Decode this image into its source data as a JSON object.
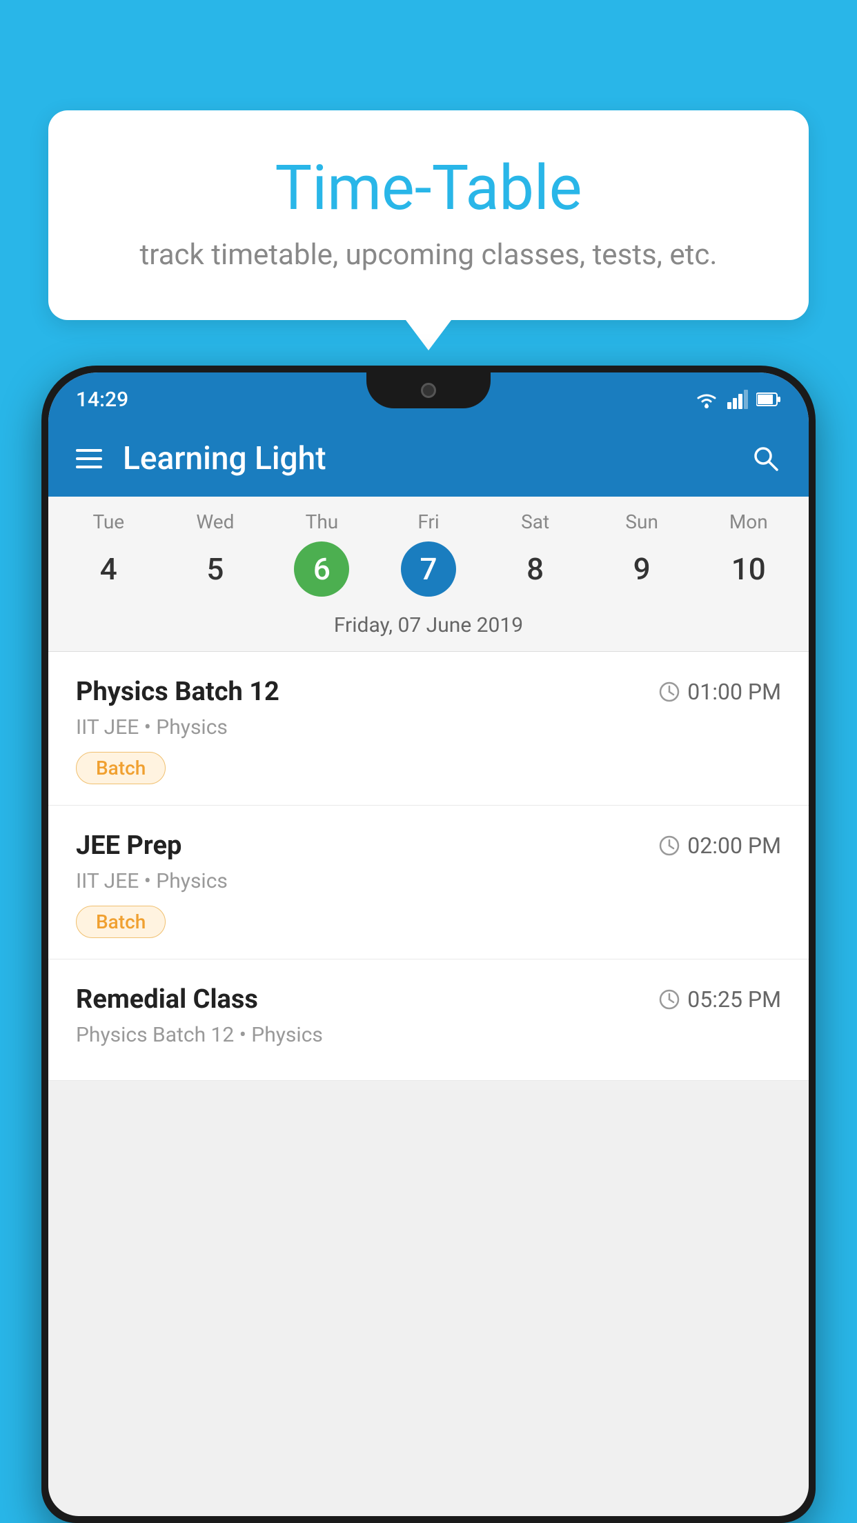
{
  "background_color": "#29b6e8",
  "tooltip": {
    "title": "Time-Table",
    "subtitle": "track timetable, upcoming classes, tests, etc."
  },
  "phone": {
    "status_bar": {
      "time": "14:29",
      "icons": [
        "wifi",
        "signal",
        "battery"
      ]
    },
    "app_bar": {
      "title": "Learning Light",
      "search_icon": "🔍"
    },
    "calendar": {
      "days": [
        {
          "name": "Tue",
          "num": "4",
          "state": "normal"
        },
        {
          "name": "Wed",
          "num": "5",
          "state": "normal"
        },
        {
          "name": "Thu",
          "num": "6",
          "state": "today"
        },
        {
          "name": "Fri",
          "num": "7",
          "state": "selected"
        },
        {
          "name": "Sat",
          "num": "8",
          "state": "normal"
        },
        {
          "name": "Sun",
          "num": "9",
          "state": "normal"
        },
        {
          "name": "Mon",
          "num": "10",
          "state": "normal"
        }
      ],
      "selected_date_label": "Friday, 07 June 2019"
    },
    "schedule": [
      {
        "title": "Physics Batch 12",
        "time": "01:00 PM",
        "subtitle": "IIT JEE • Physics",
        "badge": "Batch"
      },
      {
        "title": "JEE Prep",
        "time": "02:00 PM",
        "subtitle": "IIT JEE • Physics",
        "badge": "Batch"
      },
      {
        "title": "Remedial Class",
        "time": "05:25 PM",
        "subtitle": "Physics Batch 12 • Physics",
        "badge": null
      }
    ]
  }
}
